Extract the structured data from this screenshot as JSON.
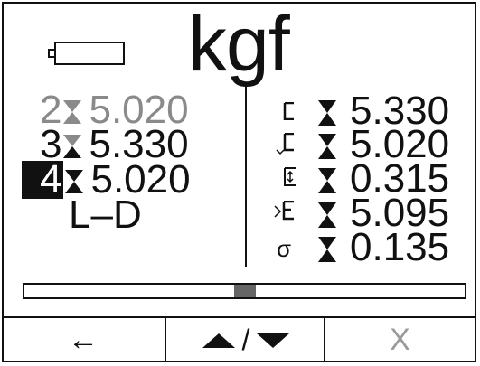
{
  "header": {
    "unit": "kgf",
    "battery_icon": "battery-empty-icon"
  },
  "readings": [
    {
      "index": "2",
      "value": "5.020",
      "state": "previous"
    },
    {
      "index": "3",
      "value": "5.330",
      "state": "previous"
    },
    {
      "index": "4",
      "value": "5.020",
      "state": "selected"
    }
  ],
  "mode_label": "L–D",
  "stats": [
    {
      "icon": "max-icon",
      "value": "5.330"
    },
    {
      "icon": "min-icon",
      "value": "5.020"
    },
    {
      "icon": "range-icon",
      "value": "0.315"
    },
    {
      "icon": "mean-icon",
      "value": "5.095"
    },
    {
      "icon": "sigma-icon",
      "symbol": "σ",
      "value": "0.135"
    }
  ],
  "progress": {
    "position_fraction": 0.5
  },
  "buttons": {
    "back_label": "←",
    "updown_separator": "/",
    "clear_label": "X"
  },
  "colors": {
    "ink": "#111111",
    "muted": "#8a8a8a",
    "thumb": "#666666"
  }
}
